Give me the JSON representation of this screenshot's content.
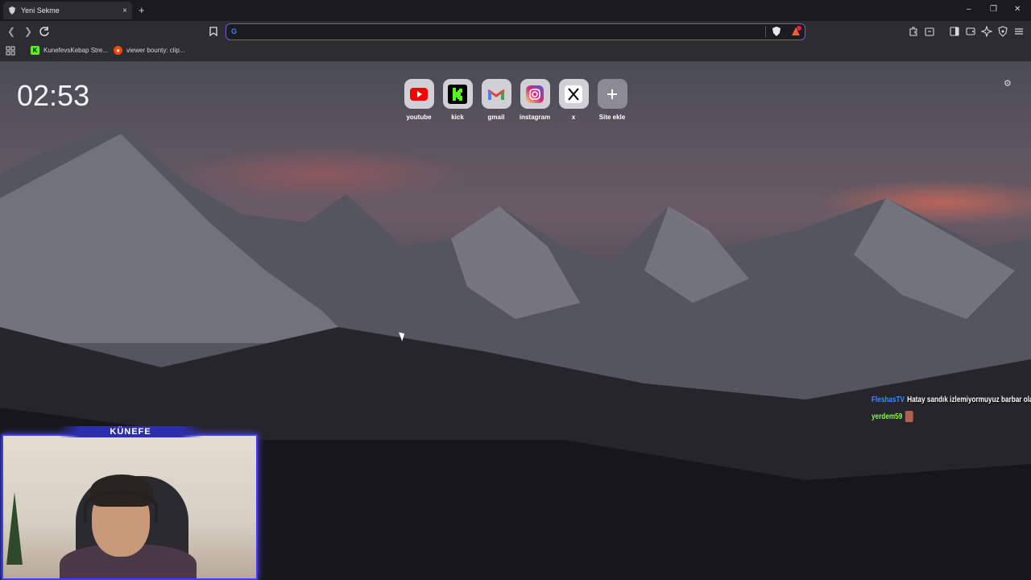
{
  "tab": {
    "title": "Yeni Sekme",
    "close": "×",
    "new_tab": "+"
  },
  "window_controls": {
    "minimize": "–",
    "restore": "❐",
    "close": "✕"
  },
  "address_bar": {
    "placeholder": "",
    "value": ""
  },
  "bookmarks": [
    {
      "label": "KunefevsKebap Stre...",
      "icon": "kick-icon",
      "color": "#53fc18"
    },
    {
      "label": "viewer bounty: clip...",
      "icon": "reddit-icon",
      "color": "#ff4500"
    }
  ],
  "clock": "02:53",
  "shortcuts": [
    {
      "label": "youtube",
      "icon": "youtube-icon"
    },
    {
      "label": "kick",
      "icon": "kick-icon"
    },
    {
      "label": "gmail",
      "icon": "gmail-icon"
    },
    {
      "label": "instagram",
      "icon": "instagram-icon"
    },
    {
      "label": "x",
      "icon": "x-icon"
    },
    {
      "label": "Site ekle",
      "icon": "plus-icon"
    }
  ],
  "chat": [
    {
      "user": "FleshasTV",
      "message": "Hatay sandık izlemiyormuyuz barbar olalım"
    },
    {
      "user": "yerdem59",
      "message": ""
    }
  ],
  "webcam": {
    "banner": "KÜNEFE"
  },
  "colors": {
    "accent": "#6f5bd6",
    "toolbar": "#2c2c31",
    "tabbar": "#1b1b1f"
  }
}
